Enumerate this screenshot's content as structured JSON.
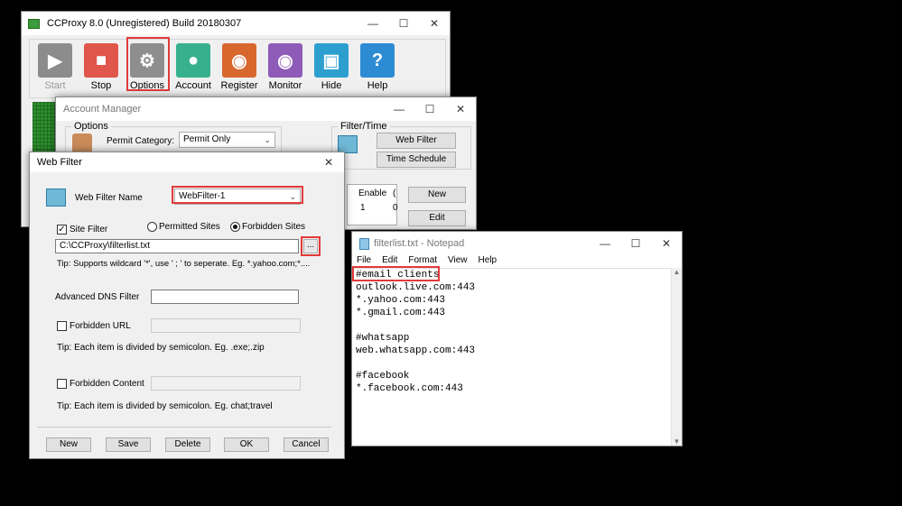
{
  "ccproxy": {
    "title": "CCProxy 8.0 (Unregistered) Build 20180307",
    "tools": [
      {
        "label": "Start",
        "icon": "play-icon",
        "color": "#8c8c8c"
      },
      {
        "label": "Stop",
        "icon": "stop-icon",
        "color": "#e0564a"
      },
      {
        "label": "Options",
        "icon": "gear-icon",
        "color": "#8e8e8e"
      },
      {
        "label": "Account",
        "icon": "user-icon",
        "color": "#37b08d"
      },
      {
        "label": "Register",
        "icon": "register-icon",
        "color": "#d8672e"
      },
      {
        "label": "Monitor",
        "icon": "eye-icon",
        "color": "#8e5bb8"
      },
      {
        "label": "Hide",
        "icon": "hide-icon",
        "color": "#2d9fcf"
      },
      {
        "label": "Help",
        "icon": "help-icon",
        "color": "#2d8bd4"
      }
    ]
  },
  "account": {
    "title": "Account Manager",
    "options_label": "Options",
    "permit_label": "Permit Category:",
    "permit_value": "Permit Only",
    "filter_time_label": "Filter/Time",
    "web_filter_btn": "Web Filter",
    "time_schedule_btn": "Time Schedule",
    "grid_header": "Enable",
    "grid_header2": "(",
    "grid_cell": "1",
    "grid_cell2": "0",
    "new_btn": "New",
    "edit_btn": "Edit"
  },
  "webfilter": {
    "title": "Web Filter",
    "name_label": "Web Filter Name",
    "name_value": "WebFilter-1",
    "site_filter_label": "Site Filter",
    "permitted_label": "Permitted Sites",
    "forbidden_label": "Forbidden Sites",
    "path_value": "C:\\CCProxy\\filterlist.txt",
    "browse_label": "...",
    "tip1": "Tip: Supports wildcard '*', use ' ; ' to seperate. Eg. *.yahoo.com;*....",
    "dns_label": "Advanced DNS Filter",
    "forbidden_url_label": "Forbidden URL",
    "tip2": "Tip: Each item is divided by semicolon. Eg. .exe;.zip",
    "forbidden_content_label": "Forbidden Content",
    "tip3": "Tip: Each item is divided by semicolon. Eg. chat;travel",
    "buttons": {
      "new": "New",
      "save": "Save",
      "delete": "Delete",
      "ok": "OK",
      "cancel": "Cancel"
    }
  },
  "notepad": {
    "title": "filterlist.txt - Notepad",
    "menu": [
      "File",
      "Edit",
      "Format",
      "View",
      "Help"
    ],
    "lines": [
      "#email clients",
      "outlook.live.com:443",
      "*.yahoo.com:443",
      "*.gmail.com:443",
      "",
      "#whatsapp",
      "web.whatsapp.com:443",
      "",
      "#facebook",
      "*.facebook.com:443"
    ]
  },
  "highlight_color": "#e23a3a"
}
